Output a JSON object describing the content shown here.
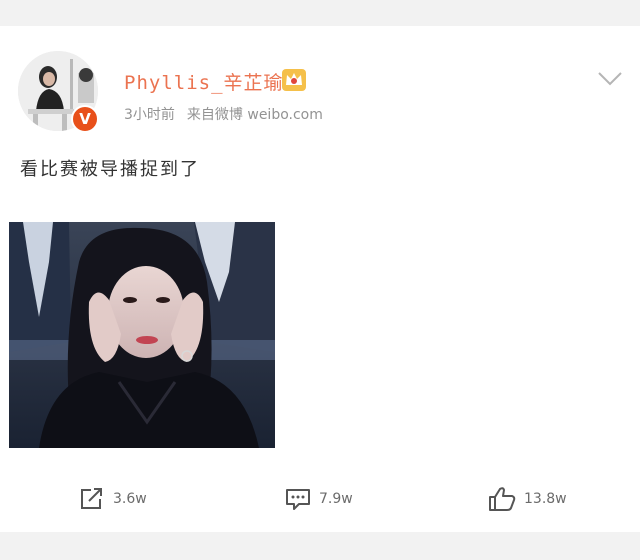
{
  "post": {
    "username": "Phyllis_辛芷瑜",
    "time": "3小时前",
    "source": "来自微博 weibo.com",
    "text": "看比赛被导播捉到了",
    "verified_badge": "V",
    "icons": [
      "crown-icon",
      "chevron-down-icon",
      "verified-badge-icon"
    ]
  },
  "actions": {
    "repost_count": "3.6w",
    "comment_count": "7.9w",
    "like_count": "13.8w",
    "icons": [
      "repost-icon",
      "comment-icon",
      "like-icon"
    ]
  },
  "colors": {
    "username": "#eb7350",
    "meta": "#939393",
    "badge": "#e8501a",
    "background": "#f2f2f2"
  }
}
